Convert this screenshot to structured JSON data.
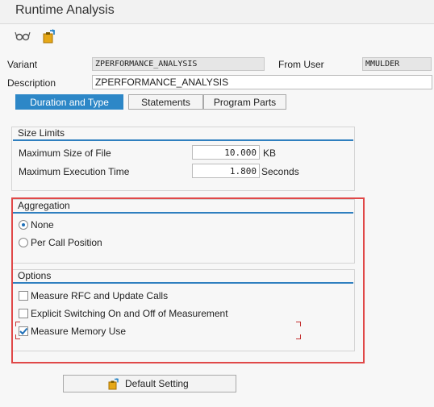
{
  "window": {
    "title": "Runtime Analysis"
  },
  "toolbar": {
    "icons": [
      "glasses-icon",
      "clipboard-transport-icon"
    ]
  },
  "fields": {
    "variant_label": "Variant",
    "variant_value": "ZPERFORMANCE_ANALYSIS",
    "from_user_label": "From User",
    "from_user_value": "MMULDER",
    "description_label": "Description",
    "description_value": "ZPERFORMANCE_ANALYSIS"
  },
  "tabs": [
    {
      "label": "Duration and Type",
      "active": true
    },
    {
      "label": "Statements",
      "active": false
    },
    {
      "label": "Program Parts",
      "active": false
    }
  ],
  "size_limits": {
    "title": "Size Limits",
    "max_file_label": "Maximum Size of File",
    "max_file_value": "10.000",
    "max_file_unit": "KB",
    "max_time_label": "Maximum Execution Time",
    "max_time_value": "1.800",
    "max_time_unit": "Seconds"
  },
  "aggregation": {
    "title": "Aggregation",
    "options": [
      {
        "label": "None",
        "checked": true
      },
      {
        "label": "Per Call Position",
        "checked": false
      }
    ]
  },
  "options": {
    "title": "Options",
    "items": [
      {
        "label": "Measure RFC and Update Calls",
        "checked": false
      },
      {
        "label": "Explicit Switching On and Off of Measurement",
        "checked": false
      },
      {
        "label": "Measure Memory Use",
        "checked": true
      }
    ]
  },
  "buttons": {
    "default_setting": "Default Setting"
  },
  "colors": {
    "accent": "#2d87c7",
    "highlight": "#e04848",
    "checkmark": "#1e6fb8"
  }
}
